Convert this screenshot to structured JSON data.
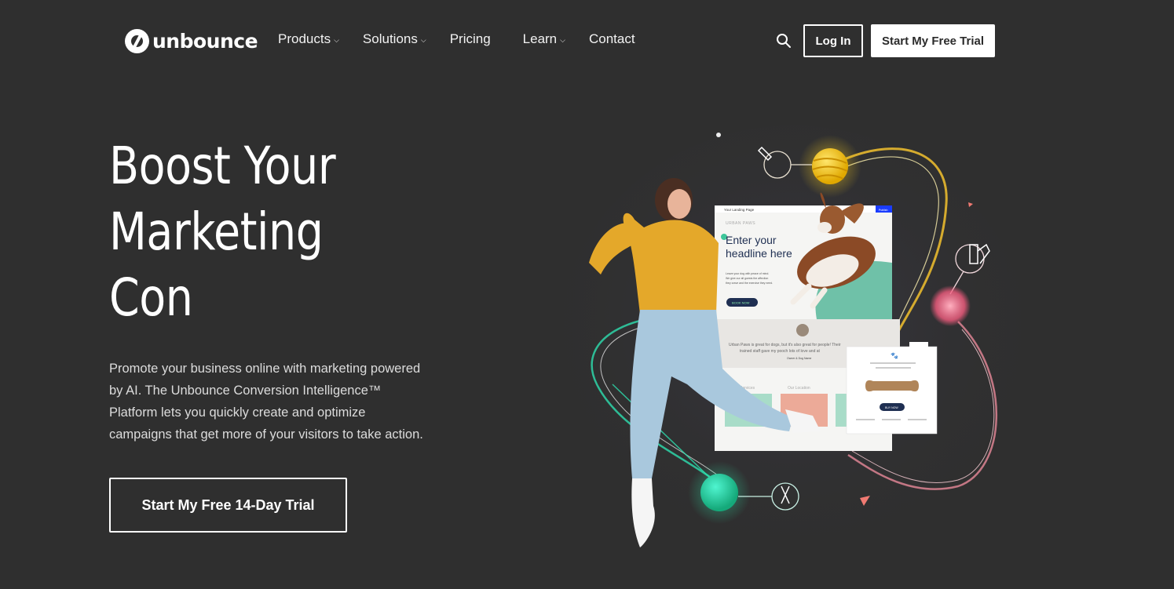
{
  "header": {
    "logo_text": "unbounce",
    "nav": [
      {
        "label": "Products",
        "has_dropdown": true
      },
      {
        "label": "Solutions",
        "has_dropdown": true
      },
      {
        "label": "Pricing",
        "has_dropdown": false
      },
      {
        "label": "Learn",
        "has_dropdown": true
      },
      {
        "label": "Contact",
        "has_dropdown": false
      }
    ],
    "dropdown_glyph": "⌄",
    "search_icon": "search-icon",
    "login_label": "Log In",
    "trial_label": "Start My Free Trial"
  },
  "hero": {
    "headline_lines": [
      "Boost Your",
      "Marketing",
      "Con"
    ],
    "subtext": "Promote your business online with marketing powered by AI. The Unbounce Conversion Intelligence™ Platform lets you quickly create and optimize campaigns that get more of your visitors to take action.",
    "cta_label": "Start My Free 14-Day Trial"
  },
  "illustration": {
    "page_title": "Your Landing Page",
    "publish_label": "Publish",
    "brand": "URBAN PAWS",
    "headline_line1": "Enter your",
    "headline_line2": "headline here",
    "body_lines": [
      "Leave your dog with peace of mind.",
      "We give our all guests the affection",
      "they crave and the exercise they need."
    ],
    "book_label": "BOOK NOW",
    "testimonial_line1": "Urban Paws is great for dogs, but it's also great for people! Their",
    "testimonial_line2": "trained staff gave my pooch lots of love and at",
    "testimonial_author": "Owner & Dog Name",
    "section_services": "Services",
    "section_location": "Our Location",
    "popup_buy_label": "BUY NOW"
  },
  "colors": {
    "background": "#2f2f2f",
    "accent_teal": "#6fc1a8",
    "accent_yellow": "#f2c12e",
    "navy": "#1f2f52",
    "publish_blue": "#1a3cff"
  }
}
